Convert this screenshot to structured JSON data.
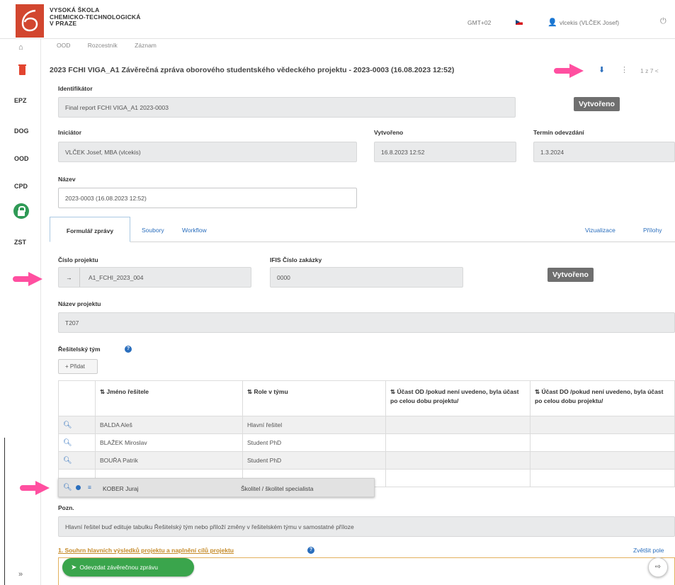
{
  "header": {
    "school_line1": "VYSOKÁ ŠKOLA",
    "school_line2": "CHEMICKO-TECHNOLOGICKÁ",
    "school_line3": "V PRAZE",
    "timezone": "GMT+02",
    "user": "vlcekis (VLČEK Josef)"
  },
  "sidebar": {
    "items": [
      "EPZ",
      "DOG",
      "OOD",
      "CPD",
      "ZST"
    ]
  },
  "breadcrumb": [
    "OOD",
    "Rozcestník",
    "Záznam"
  ],
  "page": {
    "title": "2023 FCHI VIGA_A1 Závěrečná zpráva oborového studentského vědeckého projektu - 2023-0003 (16.08.2023 12:52)",
    "pager": "1 z 7 <"
  },
  "form": {
    "identifier_label": "Identifikátor",
    "identifier_value": "Final report FCHI VIGA_A1 2023-0003",
    "status_badge": "Vytvořeno",
    "initiator_label": "Iniciátor",
    "initiator_value": "VLČEK Josef, MBA (vlcekis)",
    "created_label": "Vytvořeno",
    "created_value": "16.8.2023 12:52",
    "deadline_label": "Termín odevzdání",
    "deadline_value": "1.3.2024",
    "name_label": "Název",
    "name_value": "2023-0003 (16.08.2023 12:52)"
  },
  "tabs": {
    "form": "Formulář zprávy",
    "files": "Soubory",
    "workflow": "Workflow",
    "visualization": "Vizualizace",
    "attachments": "Přílohy"
  },
  "report": {
    "project_no_label": "Číslo projektu",
    "project_no_value": "A1_FCHI_2023_004",
    "ifis_label": "IFIS Číslo zakázky",
    "ifis_value": "0000",
    "status_badge": "Vytvořeno",
    "project_name_label": "Název projektu",
    "project_name_value": "T207",
    "team_label": "Řešitelský tým",
    "add_button": "+ Přidat",
    "columns": [
      "⇅ Jméno řešitele",
      "⇅ Role v týmu",
      "⇅ Účast OD /pokud není uvedeno, byla účast po celou dobu projektu/",
      "⇅ Účast DO /pokud není uvedeno, byla účast po celou dobu projektu/"
    ],
    "rows": [
      {
        "name": "BALDA Aleš",
        "role": "Hlavní řešitel"
      },
      {
        "name": "BLAŽEK Miroslav",
        "role": "Student PhD"
      },
      {
        "name": "BOUŘA Patrik",
        "role": "Student PhD"
      },
      {
        "name": "",
        "role": ""
      }
    ],
    "drag_row": {
      "name": "KOBER Juraj",
      "role": "Školitel / školitel specialista"
    },
    "note_label": "Pozn.",
    "note_value": "Hlavní řešitel buď edituje tabulku Řešitelský tým nebo přiloží změny v řešitelském týmu v samostatné příloze",
    "section_title": "1. Souhrn hlavních výsledků projektu a naplnění cílů projektu",
    "expand_link": "Zvětšit pole",
    "submit_button": "Odevzdat závěrečnou zprávu"
  }
}
